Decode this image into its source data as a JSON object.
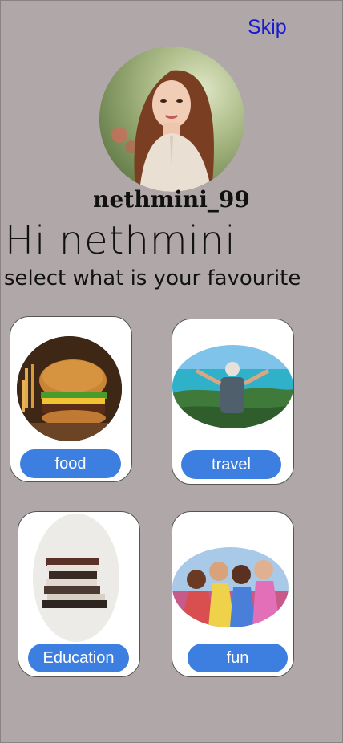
{
  "header": {
    "skip_label": "Skip"
  },
  "profile": {
    "username": "nethmini_99",
    "avatar_icon": "profile-photo"
  },
  "greeting": "Hi nethmini",
  "subtitle": "select what is your favourite",
  "categories": [
    {
      "label": "food",
      "image_icon": "burger-photo"
    },
    {
      "label": "travel",
      "image_icon": "traveler-photo"
    },
    {
      "label": "Education",
      "image_icon": "books-photo"
    },
    {
      "label": "fun",
      "image_icon": "friends-photo"
    }
  ],
  "colors": {
    "background": "#b0a8a8",
    "accent": "#3d7fe0",
    "skip": "#1a1ad0"
  }
}
